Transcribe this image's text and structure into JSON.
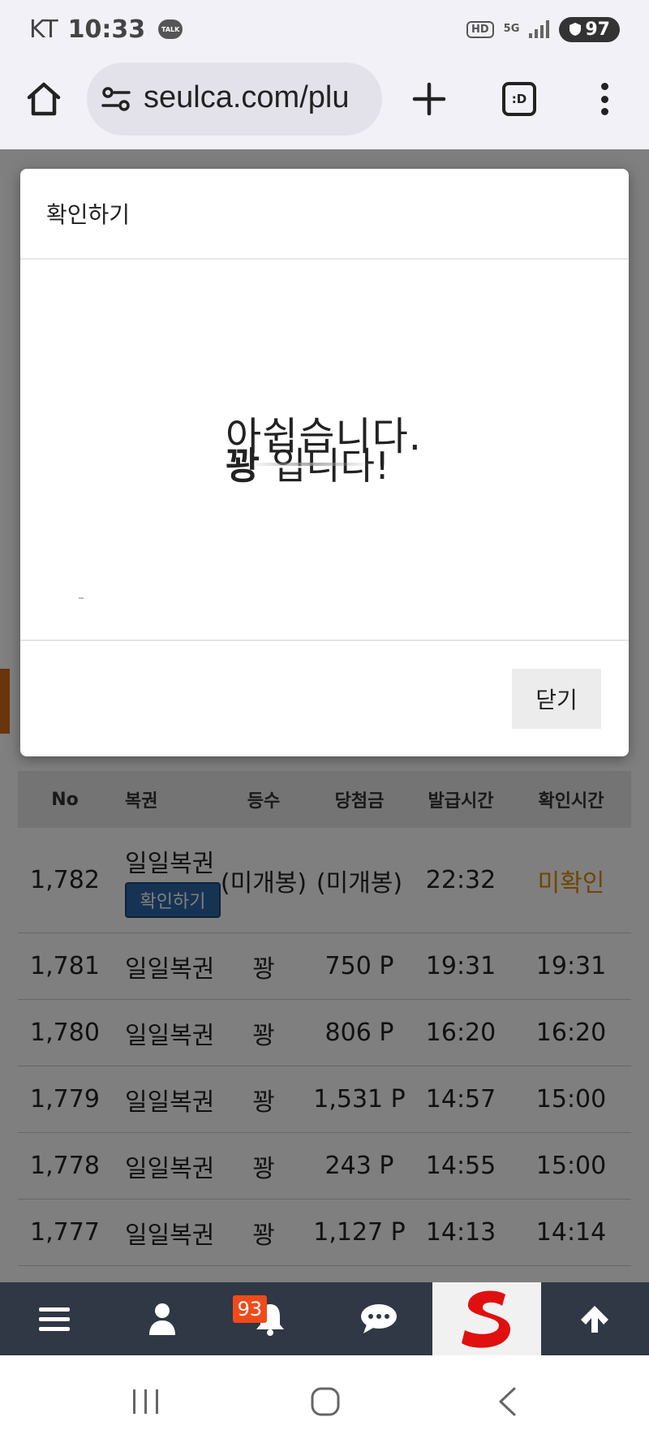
{
  "status_bar": {
    "carrier": "KT",
    "time": "10:33",
    "chat_icon_text": "TALK",
    "hd_label": "HD",
    "network_label": "5G",
    "battery_level": "97"
  },
  "browser": {
    "url": "seulca.com/plu",
    "tabs_label": ":D"
  },
  "modal": {
    "title": "확인하기",
    "result_text_top": "아쉽습니다.",
    "result_text_bottom_bold": "꽝",
    "result_text_bottom_rest": " 입니다!",
    "close_label": "닫기"
  },
  "table": {
    "headers": [
      "No",
      "복권",
      "등수",
      "당첨금",
      "발급시간",
      "확인시간"
    ],
    "rows": [
      {
        "no": "1,782",
        "kind": "일일복권",
        "button": "확인하기",
        "rank": "(미개봉)",
        "prize": "(미개봉)",
        "issued": "22:32",
        "checked": "미확인"
      },
      {
        "no": "1,781",
        "kind": "일일복권",
        "rank": "꽝",
        "prize": "750 P",
        "issued": "19:31",
        "checked": "19:31"
      },
      {
        "no": "1,780",
        "kind": "일일복권",
        "rank": "꽝",
        "prize": "806 P",
        "issued": "16:20",
        "checked": "16:20"
      },
      {
        "no": "1,779",
        "kind": "일일복권",
        "rank": "꽝",
        "prize": "1,531 P",
        "issued": "14:57",
        "checked": "15:00"
      },
      {
        "no": "1,778",
        "kind": "일일복권",
        "rank": "꽝",
        "prize": "243 P",
        "issued": "14:55",
        "checked": "15:00"
      },
      {
        "no": "1,777",
        "kind": "일일복권",
        "rank": "꽝",
        "prize": "1,127 P",
        "issued": "14:13",
        "checked": "14:14"
      }
    ]
  },
  "bottom_nav": {
    "notification_count": "93",
    "icons": [
      "menu-icon",
      "user-icon",
      "bell-icon",
      "chat-icon",
      "logo-s-icon",
      "arrow-up-icon"
    ]
  },
  "colors": {
    "accent_orange": "#e08b00",
    "nav_bg": "#2f3844",
    "badge": "#f04a1a",
    "chip_blue": "#2e67a8"
  }
}
